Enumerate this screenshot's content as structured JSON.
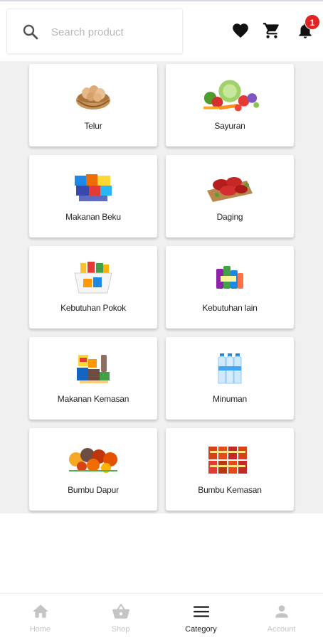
{
  "search": {
    "placeholder": "Search product"
  },
  "header": {
    "notification_count": "1"
  },
  "categories": [
    {
      "label": "Telur",
      "icon": "eggs-basket-icon"
    },
    {
      "label": "Sayuran",
      "icon": "vegetables-icon"
    },
    {
      "label": "Makanan Beku",
      "icon": "frozen-food-icon"
    },
    {
      "label": "Daging",
      "icon": "meat-icon"
    },
    {
      "label": "Kebutuhan Pokok",
      "icon": "groceries-bag-icon"
    },
    {
      "label": "Kebutuhan lain",
      "icon": "household-items-icon"
    },
    {
      "label": "Makanan Kemasan",
      "icon": "packaged-food-icon"
    },
    {
      "label": "Minuman",
      "icon": "water-bottles-icon"
    },
    {
      "label": "Bumbu Dapur",
      "icon": "spices-bowls-icon"
    },
    {
      "label": "Bumbu Kemasan",
      "icon": "packaged-seasoning-icon"
    }
  ],
  "nav": {
    "items": [
      {
        "label": "Home",
        "icon": "home-icon",
        "active": false
      },
      {
        "label": "Shop",
        "icon": "shopping-basket-icon",
        "active": false
      },
      {
        "label": "Category",
        "icon": "menu-icon",
        "active": true
      },
      {
        "label": "Account",
        "icon": "account-icon",
        "active": false
      }
    ]
  },
  "colors": {
    "badge": "#e02424",
    "active_nav": "#222222",
    "inactive_nav": "#c4c4c4",
    "background": "#f0f0f0"
  }
}
